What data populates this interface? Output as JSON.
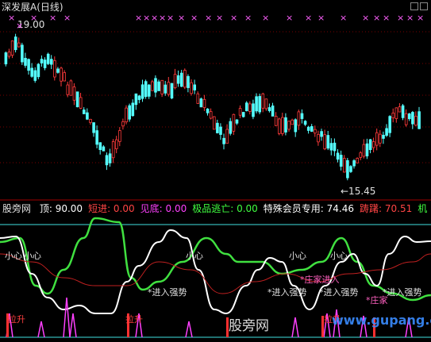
{
  "header": {
    "title": "深发展A",
    "period": "(日线)"
  },
  "window_controls": [
    "minimize-icon",
    "close-icon"
  ],
  "main_chart": {
    "high_label": "19.00",
    "low_label": "←15.45",
    "marker_glyph": "×",
    "colors": {
      "up": "#ff3b3b",
      "down": "#54ffff",
      "grid": "#7a0000",
      "marker": "#ff60ff"
    }
  },
  "indicator_header": {
    "name": "股旁网",
    "items": [
      {
        "label": "顶:",
        "value": "90.00",
        "color": "#ffffff"
      },
      {
        "label": "短进:",
        "value": "0.00",
        "color": "#ff4444"
      },
      {
        "label": "见底:",
        "value": "0.00",
        "color": "#ff40ff"
      },
      {
        "label": "极品逃亡:",
        "value": "0.00",
        "color": "#40ff40"
      },
      {
        "label": "特殊会员专用:",
        "value": "74.46",
        "color": "#ffffff"
      },
      {
        "label": "踌躇:",
        "value": "70.51",
        "color": "#ff4444"
      },
      {
        "label": "机",
        "value": "",
        "color": "#40ff40"
      }
    ]
  },
  "indicator_labels": {
    "xiaoxin": "小心",
    "jinru": "*进入强势",
    "lasheng": "拉升",
    "zhuang_ru": "*庄家进入",
    "zhuang": "*庄家"
  },
  "watermark": {
    "left": "股旁网",
    "right": "www.gupang.com"
  }
}
